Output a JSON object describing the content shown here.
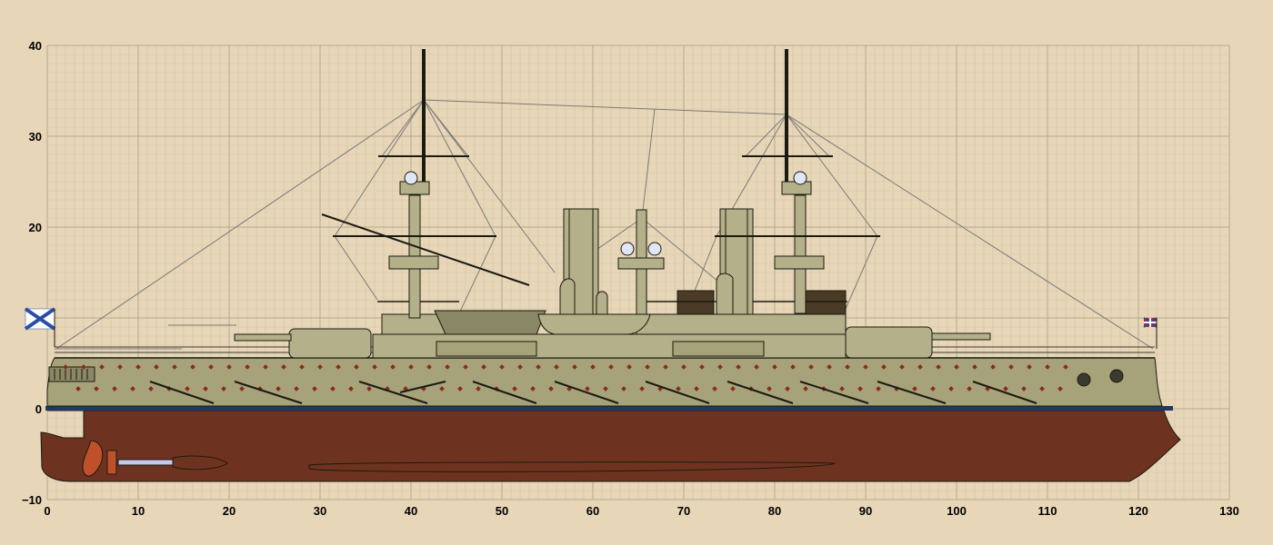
{
  "drawing": {
    "x_axis": {
      "min": 0,
      "max": 130,
      "major_step": 10,
      "minor_step": 1,
      "tick_labels": [
        "0",
        "10",
        "20",
        "30",
        "40",
        "50",
        "60",
        "70",
        "80",
        "90",
        "100",
        "110",
        "120",
        "130"
      ]
    },
    "y_axis": {
      "min": -10,
      "max": 40,
      "major_step": 10,
      "minor_step": 1,
      "tick_labels": [
        "−10",
        "0",
        "10",
        "20",
        "30",
        "40"
      ]
    },
    "grid": true
  },
  "ship": {
    "colors": {
      "hull_upper": "#a6a37a",
      "hull_lower": "#6e3320",
      "boot_top": "#1e3a5f",
      "superstructure": "#b4b08a",
      "dark_fittings": "#4a3a26",
      "line": "#1a1a10",
      "rigging": "#7a7a7a",
      "propeller": "#c0502a",
      "shaft": "#c8c8e8",
      "port_markers": "#8b2a20",
      "stern_flag_blue": "#2a4ea8",
      "bow_flag_red": "#c02020"
    },
    "icons": [
      "st-andrews-ensign-icon",
      "jack-flag-icon",
      "propeller-icon",
      "searchlight-icon",
      "anchor-icon"
    ]
  }
}
